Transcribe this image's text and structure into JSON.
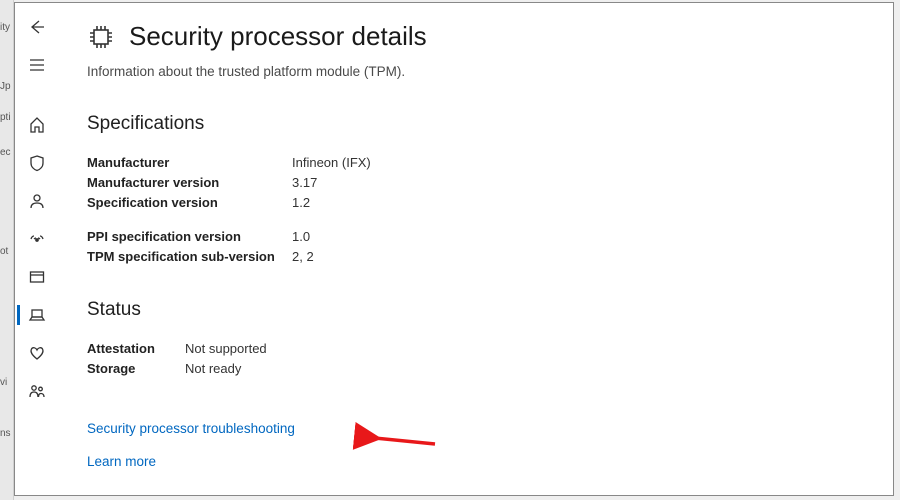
{
  "leftstrip": [
    "ity",
    "Jp",
    "pti",
    "ec",
    "ot",
    "vi",
    "ns"
  ],
  "page": {
    "title": "Security processor details",
    "info": "Information about the trusted platform module (TPM)."
  },
  "specs": {
    "heading": "Specifications",
    "group1": [
      {
        "label": "Manufacturer",
        "value": "Infineon (IFX)"
      },
      {
        "label": "Manufacturer version",
        "value": "3.17"
      },
      {
        "label": "Specification version",
        "value": "1.2"
      }
    ],
    "group2": [
      {
        "label": "PPI specification version",
        "value": "1.0"
      },
      {
        "label": "TPM specification sub-version",
        "value": "2, 2"
      }
    ]
  },
  "status": {
    "heading": "Status",
    "rows": [
      {
        "label": "Attestation",
        "value": "Not supported"
      },
      {
        "label": "Storage",
        "value": "Not ready"
      }
    ]
  },
  "links": {
    "troubleshoot": "Security processor troubleshooting",
    "learn": "Learn more"
  }
}
